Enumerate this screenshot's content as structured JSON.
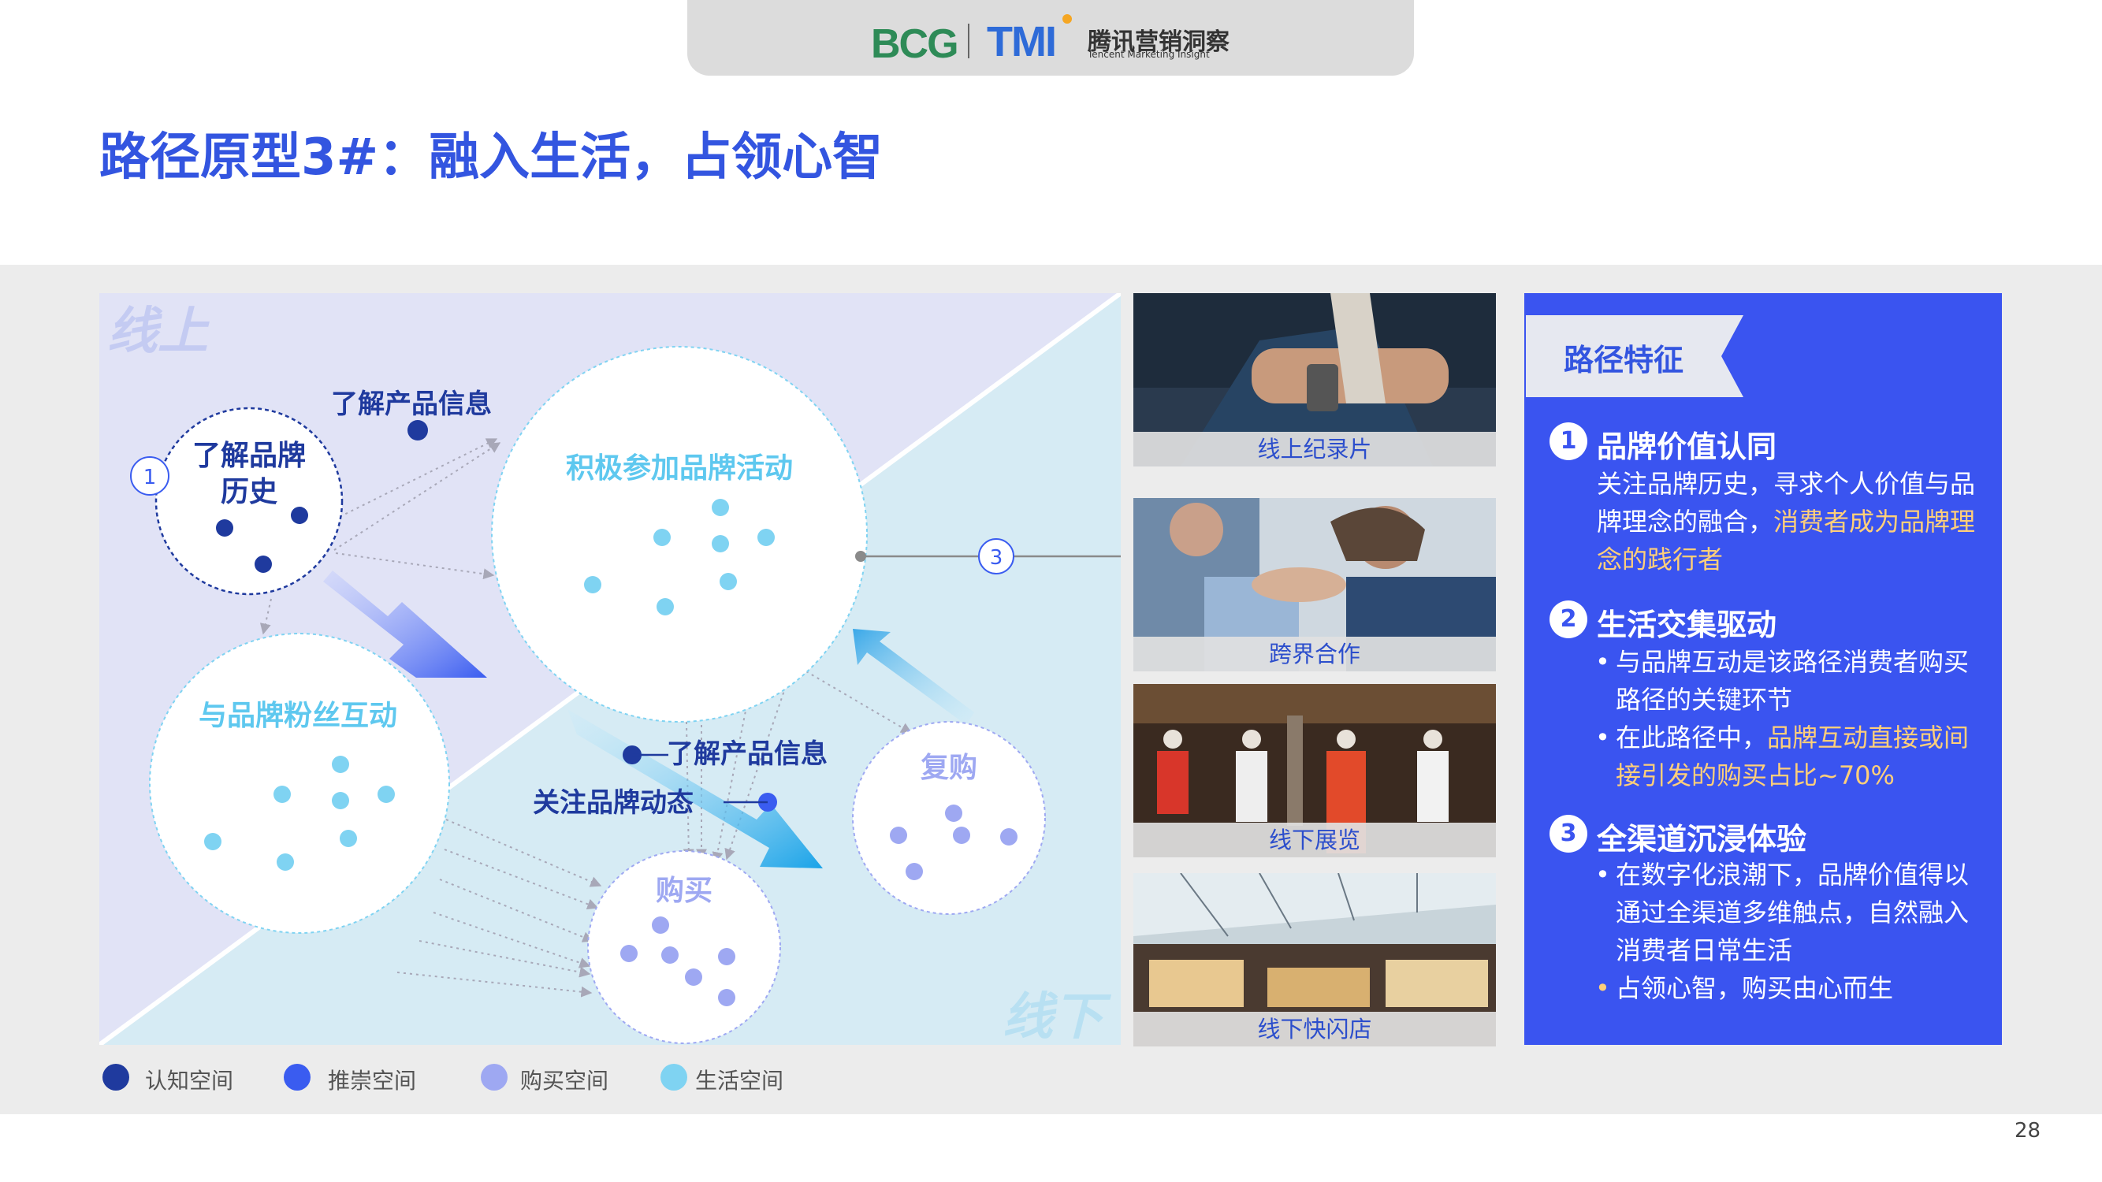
{
  "header": {
    "logo_bcg": "BCG",
    "logo_tmi": "TMI",
    "logo_cn": "腾讯营销洞察",
    "logo_en": "Tencent Marketing Insight"
  },
  "title": "路径原型3#：融入生活，占领心智",
  "page_number": "28",
  "colors": {
    "title_blue": "#3355e0",
    "panel_blue": "#3a54f0",
    "highlight_orange": "#ffcf7a",
    "online_bg": "#e0e2f5",
    "offline_bg": "#d8ecf5"
  },
  "diagram": {
    "zone_online": "线上",
    "zone_offline": "线下",
    "circle_brand_history": "了解品牌\n历史",
    "circle_brand_history_num": "1",
    "label_product_info_top": "了解产品信息",
    "circle_brand_activity": "积极参加品牌活动",
    "circle_fan_interaction": "与品牌粉丝互动",
    "label_product_info_mid": "了解产品信息",
    "label_follow_brand": "关注品牌动态",
    "circle_purchase": "购买",
    "circle_repurchase": "复购",
    "callout_num": "3"
  },
  "photos": [
    {
      "caption": "线上纪录片",
      "icon": "watch-photo"
    },
    {
      "caption": "跨界合作",
      "icon": "handshake-photo"
    },
    {
      "caption": "线下展览",
      "icon": "mannequin-photo"
    },
    {
      "caption": "线下快闪店",
      "icon": "mall-photo"
    }
  ],
  "panel": {
    "tag": "路径特征",
    "features": [
      {
        "num": "1",
        "title": "品牌价值认同",
        "body_plain": "关注品牌历史，寻求个人价值与品牌理念的融合，",
        "body_highlight": "消费者成为品牌理念的践行者"
      },
      {
        "num": "2",
        "title": "生活交集驱动",
        "bullet1": "与品牌互动是该路径消费者购买路径的关键环节",
        "bullet2_plain": "在此路径中，",
        "bullet2_highlight": "品牌互动直接或间接引发的购买占比~70%"
      },
      {
        "num": "3",
        "title": "全渠道沉浸体验",
        "bullet1": "在数字化浪潮下，品牌价值得以通过全渠道多维触点，自然融入消费者日常生活",
        "bullet2_highlight": "占领心智，购买由心而生"
      }
    ]
  },
  "legend": [
    {
      "label": "认知空间",
      "color": "#1f3a9e"
    },
    {
      "label": "推崇空间",
      "color": "#3a5cf0"
    },
    {
      "label": "购买空间",
      "color": "#9ea8f2"
    },
    {
      "label": "生活空间",
      "color": "#7fd3f2"
    }
  ]
}
